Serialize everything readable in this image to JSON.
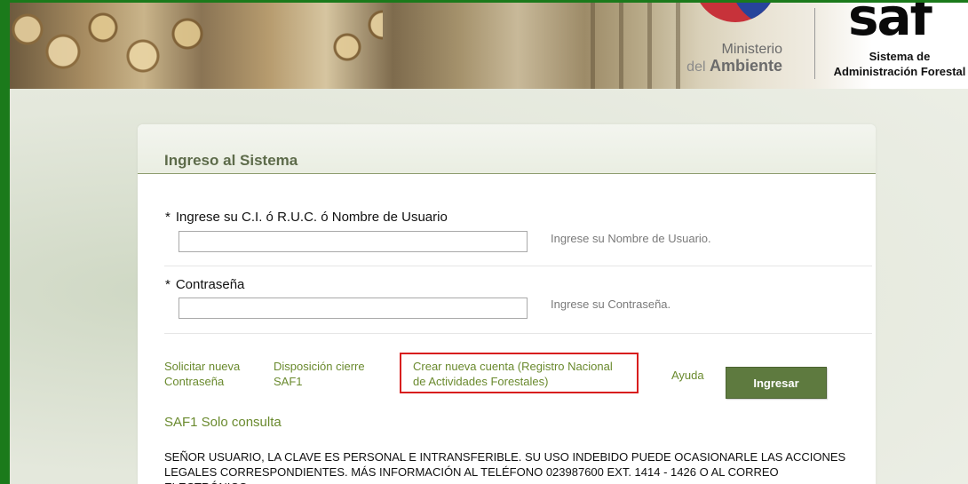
{
  "header": {
    "ministerio_line1": "Ministerio",
    "ministerio_del": "del",
    "ministerio_line2": "Ambiente",
    "saf_logo": "saf",
    "saf_subtitle_1": "Sistema de",
    "saf_subtitle_2": "Administración Forestal"
  },
  "login": {
    "title": "Ingreso al Sistema",
    "required_mark": "*",
    "user_label": "Ingrese su C.I. ó R.U.C. ó Nombre de Usuario",
    "user_value": "",
    "user_hint": "Ingrese su Nombre de Usuario.",
    "password_label": "Contraseña",
    "password_value": "",
    "password_hint": "Ingrese su Contraseña.",
    "links": {
      "request_password_1": "Solicitar nueva",
      "request_password_2": "Contraseña",
      "closure_1": "Disposición cierre",
      "closure_2": "SAF1",
      "create_account_1": "Crear nueva cuenta (Registro Nacional",
      "create_account_2": "de Actividades Forestales)",
      "help": "Ayuda"
    },
    "submit_label": "Ingresar",
    "consulta_link": "SAF1 Solo consulta",
    "notice": "SEÑOR USUARIO, LA CLAVE ES PERSONAL E INTRANSFERIBLE. SU USO INDEBIDO PUEDE OCASIONARLE LAS ACCIONES LEGALES CORRESPONDIENTES. MÁS INFORMACIÓN AL TELÉFONO 023987600 EXT. 1414 - 1426 O AL CORREO ELECTRÓNICO"
  },
  "colors": {
    "frame_green": "#1b7a1b",
    "link_green": "#6a8a2e",
    "button_green": "#5e7a3f",
    "highlight_red": "#d81e1e"
  }
}
